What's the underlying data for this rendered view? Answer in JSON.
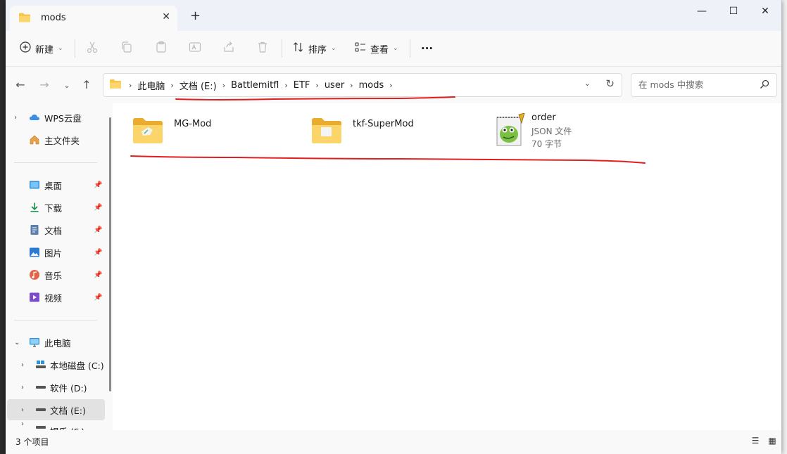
{
  "window": {
    "tab_title": "mods",
    "new_tab_label": "+",
    "min_label": "—",
    "max_label": "☐",
    "close_label": "✕",
    "tab_close_label": "✕"
  },
  "toolbar": {
    "new_label": "新建",
    "sort_label": "排序",
    "view_label": "查看",
    "more_label": "···"
  },
  "address": {
    "crumbs": [
      "此电脑",
      "文档 (E:)",
      "Battlemitfl",
      "ETF",
      "user",
      "mods"
    ],
    "search_placeholder": "在 mods 中搜索"
  },
  "sidebar": {
    "items": [
      {
        "label": "WPS云盘",
        "icon": "cloud-icon"
      },
      {
        "label": "主文件夹",
        "icon": "home-icon"
      },
      {
        "label": "桌面",
        "icon": "desktop-icon"
      },
      {
        "label": "下载",
        "icon": "download-icon"
      },
      {
        "label": "文档",
        "icon": "document-icon"
      },
      {
        "label": "图片",
        "icon": "picture-icon"
      },
      {
        "label": "音乐",
        "icon": "music-icon"
      },
      {
        "label": "视频",
        "icon": "video-icon"
      },
      {
        "label": "此电脑",
        "icon": "computer-icon"
      },
      {
        "label": "本地磁盘 (C:)",
        "icon": "drive-icon"
      },
      {
        "label": "软件 (D:)",
        "icon": "drive-icon"
      },
      {
        "label": "文档 (E:)",
        "icon": "drive-icon"
      },
      {
        "label": "娱乐 (F:)",
        "icon": "drive-icon"
      }
    ]
  },
  "files": [
    {
      "name": "MG-Mod",
      "type": "folder"
    },
    {
      "name": "tkf-SuperMod",
      "type": "folder"
    },
    {
      "name": "order",
      "type": "json",
      "type_label": "JSON 文件",
      "size": "70 字节"
    }
  ],
  "status": {
    "item_count": "3 个项目"
  },
  "colors": {
    "accent": "#0067c0",
    "folder": "#f8c54a",
    "annotation": "#e02020"
  }
}
